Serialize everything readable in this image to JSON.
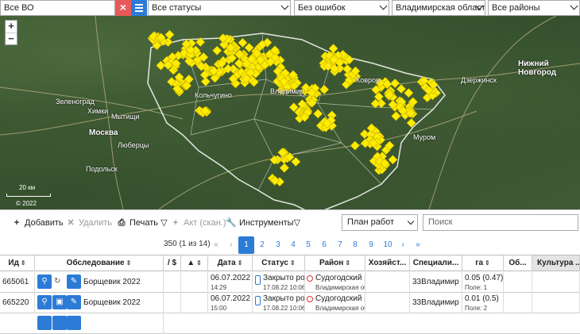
{
  "filters": {
    "vo": "Все ВО",
    "status": "Все статусы",
    "errors": "Без ошибок",
    "region": "Владимирская область",
    "district": "Все районы"
  },
  "map": {
    "labels": [
      "Москва",
      "Зеленоград",
      "Химки",
      "Мытищи",
      "Люберцы",
      "Подольск",
      "Нижний Новгород",
      "Дзержинск",
      "Владимир",
      "Ковров",
      "Муром",
      "Кольчугино"
    ],
    "scale": "20 км",
    "copyright": "© 2022"
  },
  "toolbar": {
    "add": "Добавить",
    "delete": "Удалить",
    "print": "Печать",
    "act": "Акт (скан.)",
    "tools": "Инструменты",
    "plan": "План работ",
    "search_placeholder": "Поиск"
  },
  "pager": {
    "count": "350 (1 из 14)",
    "pages": [
      "1",
      "2",
      "3",
      "4",
      "5",
      "6",
      "7",
      "8",
      "9",
      "10"
    ],
    "first": "«",
    "prev": "‹",
    "next": "›",
    "last": "»"
  },
  "table": {
    "headers": {
      "id": "Ид",
      "survey": "Обследование",
      "money": "/ $",
      "warn": "",
      "date": "Дата",
      "status": "Статус",
      "district": "Район",
      "owner": "Хозяйст...",
      "specialist": "Специали...",
      "ha": "га",
      "ob": "Об...",
      "culture": "Культура ..."
    },
    "rows": [
      {
        "id": "665061",
        "survey": "Борщевик 2022",
        "date": "06.07.2022",
        "time": "14:29",
        "status": "Закрыто ро...",
        "status_date": "17.08.22 10:06",
        "district": "Судогодский ра...",
        "region": "Владимирская обла...",
        "specialist": "33Владимир",
        "ha": "0.05 (0.47)",
        "field": "Поле: 1"
      },
      {
        "id": "665220",
        "survey": "Борщевик 2022",
        "date": "06.07.2022",
        "time": "15:00",
        "status": "Закрыто ро...",
        "status_date": "17.08.22 10:06",
        "district": "Судогодский ра...",
        "region": "Владимирская обла...",
        "specialist": "33Владимир",
        "ha": "0.01 (0.5)",
        "field": "Поле: 2"
      }
    ]
  }
}
